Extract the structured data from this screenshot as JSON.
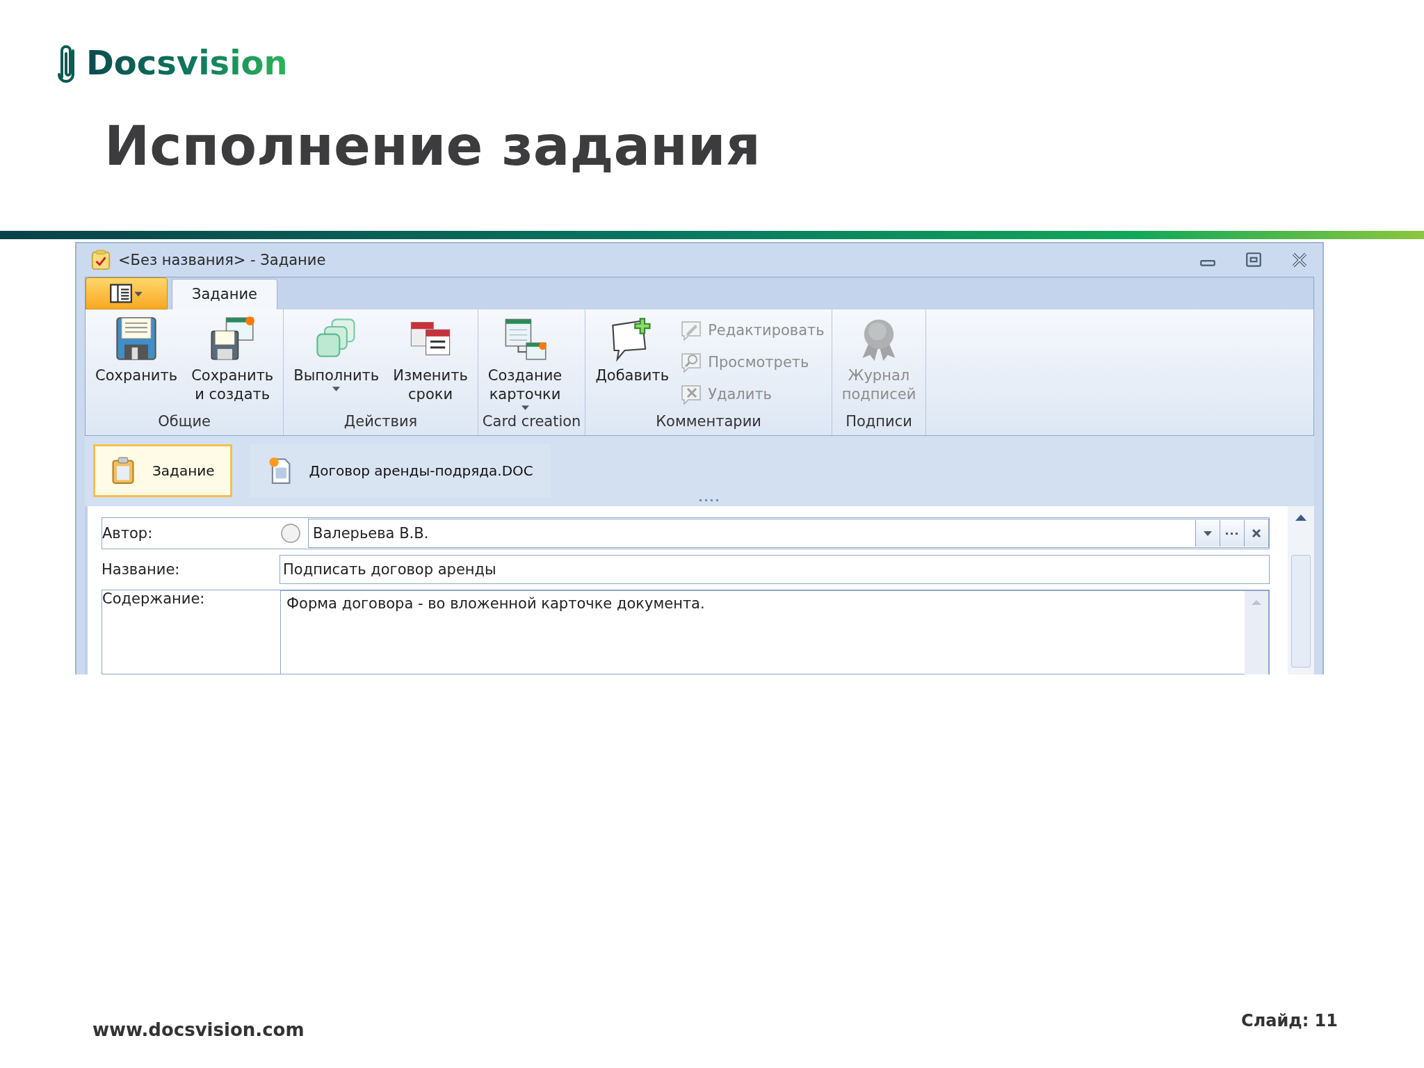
{
  "brand": {
    "name": "Docsvision"
  },
  "slide_title": "Исполнение задания",
  "window": {
    "title": "<Без названия> - Задание",
    "ribbon_tabs": [
      {
        "label": "Задание",
        "selected": true
      }
    ],
    "ribbon_groups": [
      {
        "label": "Общие",
        "items": [
          {
            "kind": "large",
            "label": "Сохранить",
            "disabled": false,
            "dropdown": false
          },
          {
            "kind": "large",
            "label": "Сохранить\nи создать",
            "disabled": false,
            "dropdown": false
          }
        ]
      },
      {
        "label": "Действия",
        "items": [
          {
            "kind": "large",
            "label": "Выполнить",
            "disabled": false,
            "dropdown": true
          },
          {
            "kind": "large",
            "label": "Изменить\nсроки",
            "disabled": false,
            "dropdown": false
          }
        ]
      },
      {
        "label": "Card creation",
        "items": [
          {
            "kind": "large",
            "label": "Создание\nкарточки",
            "disabled": false,
            "dropdown": true
          }
        ]
      },
      {
        "label": "Комментарии",
        "items": [
          {
            "kind": "large",
            "label": "Добавить",
            "disabled": false,
            "dropdown": false
          },
          {
            "kind": "small",
            "label": "Редактировать",
            "disabled": true
          },
          {
            "kind": "small",
            "label": "Просмотреть",
            "disabled": true
          },
          {
            "kind": "small",
            "label": "Удалить",
            "disabled": true
          }
        ]
      },
      {
        "label": "Подписи",
        "items": [
          {
            "kind": "large",
            "label": "Журнал\nподписей",
            "disabled": true,
            "dropdown": false
          }
        ]
      }
    ],
    "card_tabs": [
      {
        "label": "Задание",
        "selected": true
      },
      {
        "label": "Договор аренды-подряда.DOC",
        "selected": false
      }
    ],
    "fields": [
      {
        "kind": "lookup",
        "label": "Автор:",
        "value": "Валерьева В.В.",
        "selected": false
      },
      {
        "kind": "text",
        "label": "Название:",
        "value": "Подписать договор аренды"
      },
      {
        "kind": "memo",
        "label": "Содержание:",
        "value": "Форма договора - во вложенной карточке документа."
      }
    ]
  },
  "footer": {
    "url": "www.docsvision.com",
    "slide": "Слайд: 11"
  }
}
